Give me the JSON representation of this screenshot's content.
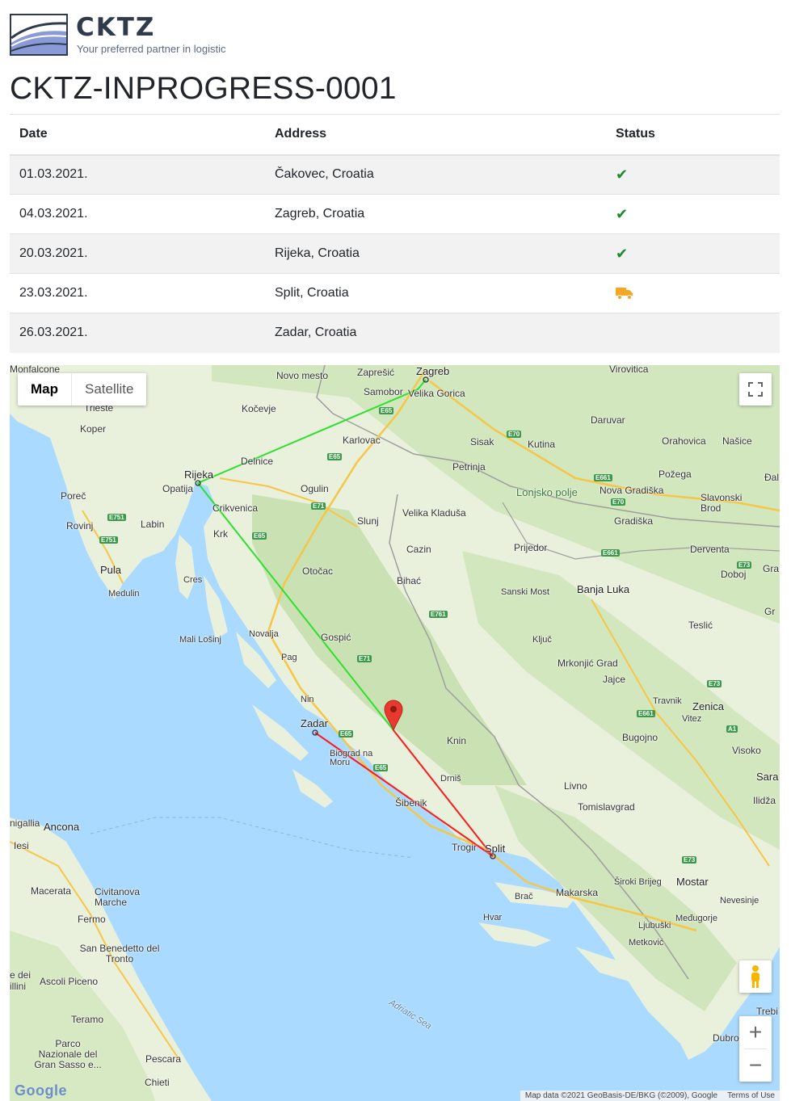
{
  "brand": {
    "name": "CKTZ",
    "tagline": "Your preferred partner in logistic"
  },
  "page_title": "CKTZ-INPROGRESS-0001",
  "table": {
    "headers": {
      "date": "Date",
      "address": "Address",
      "status": "Status"
    },
    "rows": [
      {
        "date": "01.03.2021.",
        "address": "Čakovec, Croatia",
        "status": "done",
        "status_icon": "check-icon"
      },
      {
        "date": "04.03.2021.",
        "address": "Zagreb, Croatia",
        "status": "done",
        "status_icon": "check-icon"
      },
      {
        "date": "20.03.2021.",
        "address": "Rijeka, Croatia",
        "status": "done",
        "status_icon": "check-icon"
      },
      {
        "date": "23.03.2021.",
        "address": "Split, Croatia",
        "status": "in-transit",
        "status_icon": "truck-icon"
      },
      {
        "date": "26.03.2021.",
        "address": "Zadar, Croatia",
        "status": "pending",
        "status_icon": ""
      }
    ]
  },
  "colors": {
    "check": "#1e8a2c",
    "truck": "#f5a623",
    "route_done": "#2ee02e",
    "route_pending": "#ff1a1a",
    "marker": "#e8392f"
  },
  "map": {
    "type_buttons": {
      "map": "Map",
      "satellite": "Satellite"
    },
    "active_type": "Map",
    "attribution": "Map data ©2021 GeoBasis-DE/BKG (©2009), Google",
    "terms": "Terms of Use",
    "google_logo": "Google",
    "labels": {
      "zagreb": "Zagreb",
      "zapresic": "Zaprešić",
      "samobor": "Samobor",
      "velika_gorica": "Velika Gorica",
      "novo_mesto": "Novo mesto",
      "kocevje": "Kočevje",
      "virovitica": "Virovitica",
      "karlovac": "Karlovac",
      "sisak": "Sisak",
      "kutina": "Kutina",
      "daruvar": "Daruvar",
      "orahovica": "Orahovica",
      "nasice": "Našice",
      "petrinja": "Petrinja",
      "rijeka": "Rijeka",
      "opatija": "Opatija",
      "delnice": "Delnice",
      "ogulin": "Ogulin",
      "pozega": "Požega",
      "lonjsko_polje": "Lonjsko polje",
      "nova_gradiska": "Nova Gradiška",
      "slavonski_brod": "Slavonski Brod",
      "trieste": "Trieste",
      "koper": "Koper",
      "porec": "Poreč",
      "rovinj": "Rovinj",
      "labin": "Labin",
      "crikvenica": "Crikvenica",
      "krk": "Krk",
      "velika_kladusa": "Velika Kladuša",
      "slunj": "Slunj",
      "gradiska": "Gradiška",
      "prijedor": "Prijedor",
      "derventa": "Derventa",
      "cazin": "Cazin",
      "pula": "Pula",
      "medulin": "Medulin",
      "cres": "Cres",
      "otocac": "Otočac",
      "bihac": "Bihać",
      "sanski_most": "Sanski Most",
      "banja_luka": "Banja Luka",
      "doboj": "Doboj",
      "teslic": "Teslić",
      "mali_losinj": "Mali Lošinj",
      "novalja": "Novalja",
      "gospic": "Gospić",
      "kljuc": "Ključ",
      "pag": "Pag",
      "mrkonjic_grad": "Mrkonjić Grad",
      "jajce": "Jajce",
      "nin": "Nin",
      "travnik": "Travnik",
      "zenica": "Zenica",
      "zadar": "Zadar",
      "vitez": "Vitez",
      "knin": "Knin",
      "bugojno": "Bugojno",
      "biograd": "Biograd na Moru",
      "visoko": "Visoko",
      "drnis": "Drniš",
      "livno": "Livno",
      "sibenik": "Šibenik",
      "tomislavgrad": "Tomislavgrad",
      "ancona": "Ancona",
      "trogir": "Trogir",
      "split": "Split",
      "macerata": "Macerata",
      "civitanova": "Civitanova Marche",
      "brac": "Brač",
      "makarska": "Makarska",
      "siroki_brijeg": "Široki Brijeg",
      "mostar": "Mostar",
      "nevesinje": "Nevesinje",
      "fermo": "Fermo",
      "hvar": "Hvar",
      "medjugorje": "Međugorje",
      "ljubuski": "Ljubuški",
      "metkovic": "Metković",
      "san_benedetto": "San Benedetto del Tronto",
      "ascoli": "Ascoli Piceno",
      "adriatic": "Adriatic Sea",
      "teramo": "Teramo",
      "trebinje": "Trebi",
      "parco": "Parco Nazionale del Gran Sasso e...",
      "pescara": "Pescara",
      "chieti": "Chieti",
      "dubrovnik": "Dubro",
      "monfalcone": "Monfalcone",
      "senigallia": "nigallia",
      "iesi": "Iesi",
      "sara": "Sara",
      "ilidza": "Ilidža",
      "dal": "Đal",
      "gra": "Gra",
      "gr": "Gr",
      "billini": "illini",
      "del": "e dei"
    },
    "roads": [
      "E65",
      "E70",
      "E661",
      "E751",
      "E71",
      "E761",
      "E73",
      "A1"
    ]
  }
}
